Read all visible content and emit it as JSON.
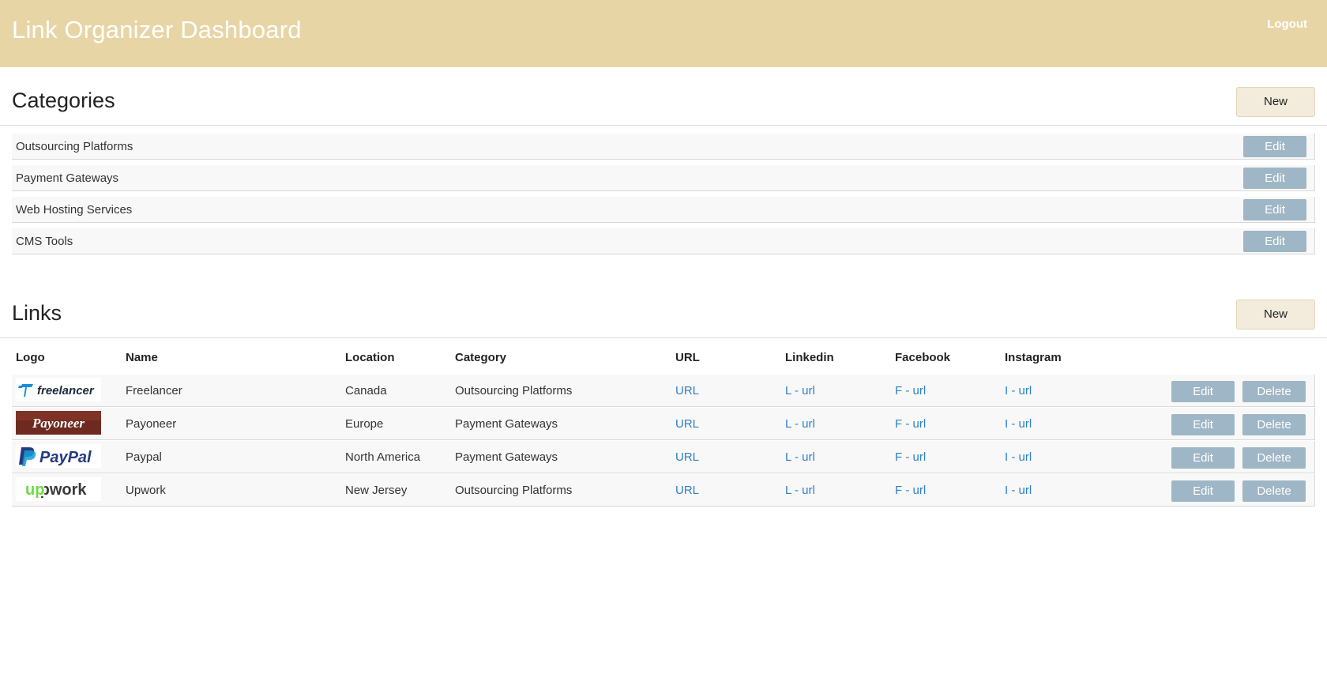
{
  "header": {
    "title": "Link Organizer Dashboard",
    "logout": "Logout",
    "color": "#e8d5a5"
  },
  "categories": {
    "title": "Categories",
    "new_label": "New",
    "edit_label": "Edit",
    "items": [
      {
        "label": "Outsourcing Platforms"
      },
      {
        "label": "Payment Gateways"
      },
      {
        "label": "Web Hosting Services"
      },
      {
        "label": "CMS Tools"
      }
    ]
  },
  "links": {
    "title": "Links",
    "new_label": "New",
    "edit_label": "Edit",
    "delete_label": "Delete",
    "columns": [
      "Logo",
      "Name",
      "Location",
      "Category",
      "URL",
      "Linkedin",
      "Facebook",
      "Instagram"
    ],
    "rows": [
      {
        "logo": "freelancer",
        "logo_text": "freelancer",
        "name": "Freelancer",
        "location": "Canada",
        "category": "Outsourcing Platforms",
        "url": "URL",
        "linkedin": "L - url",
        "facebook": "F - url",
        "instagram": "I - url"
      },
      {
        "logo": "payoneer",
        "logo_text": "Payoneer",
        "name": "Payoneer",
        "location": "Europe",
        "category": "Payment Gateways",
        "url": "URL",
        "linkedin": "L - url",
        "facebook": "F - url",
        "instagram": "I - url"
      },
      {
        "logo": "paypal",
        "logo_text": "PayPal",
        "name": "Paypal",
        "location": "North America",
        "category": "Payment Gateways",
        "url": "URL",
        "linkedin": "L - url",
        "facebook": "F - url",
        "instagram": "I - url"
      },
      {
        "logo": "upwork",
        "logo_text": "upwork",
        "name": "Upwork",
        "location": "New Jersey",
        "category": "Outsourcing Platforms",
        "url": "URL",
        "linkedin": "L - url",
        "facebook": "F - url",
        "instagram": "I - url"
      }
    ]
  }
}
